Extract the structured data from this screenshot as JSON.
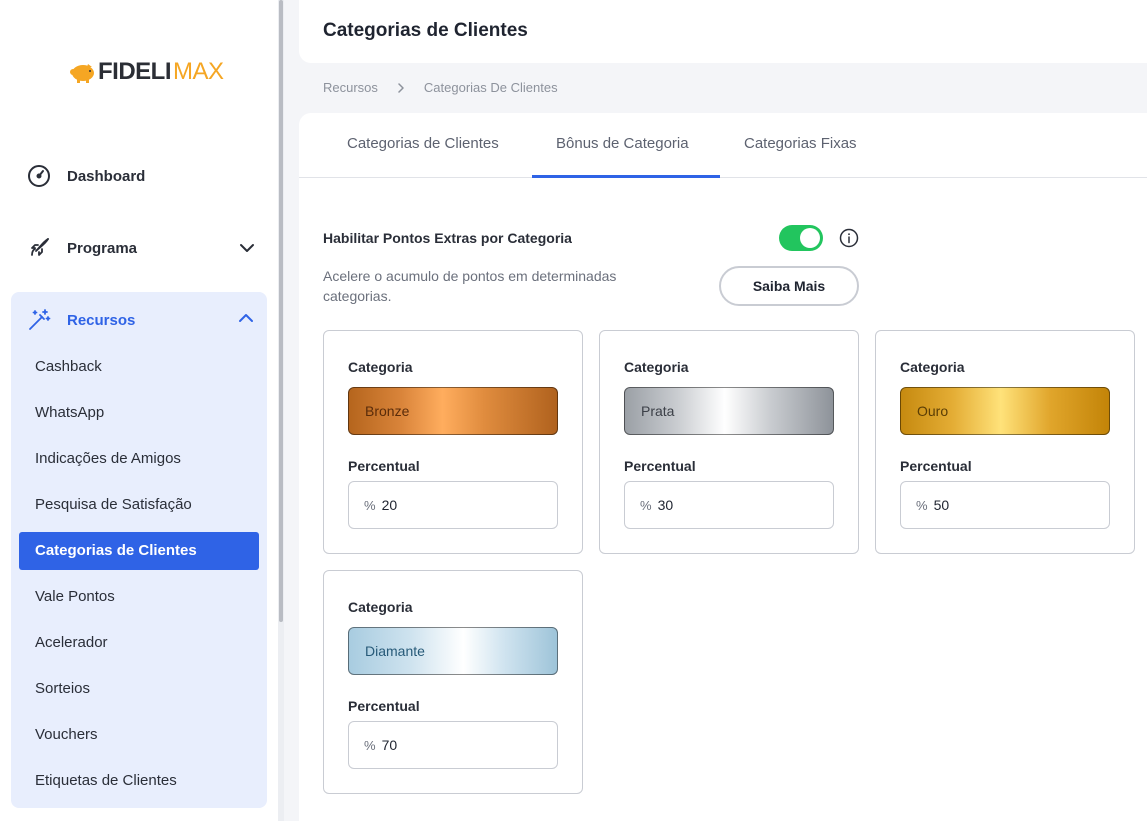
{
  "app": {
    "logo_part1": "FIDELI",
    "logo_part2": "MAX"
  },
  "sidebar": {
    "dashboard_label": "Dashboard",
    "programa_label": "Programa",
    "recursos_label": "Recursos",
    "items": [
      {
        "label": "Cashback"
      },
      {
        "label": "WhatsApp"
      },
      {
        "label": "Indicações de Amigos"
      },
      {
        "label": "Pesquisa de Satisfação"
      },
      {
        "label": "Categorias de Clientes",
        "active": true
      },
      {
        "label": "Vale Pontos"
      },
      {
        "label": "Acelerador"
      },
      {
        "label": "Sorteios"
      },
      {
        "label": "Vouchers"
      },
      {
        "label": "Etiquetas de Clientes"
      }
    ]
  },
  "header": {
    "title": "Categorias de Clientes"
  },
  "breadcrumb": {
    "items": [
      "Recursos",
      "Categorias De Clientes"
    ]
  },
  "tabs": [
    {
      "label": "Categorias de Clientes"
    },
    {
      "label": "Bônus de Categoria",
      "active": true
    },
    {
      "label": "Categorias Fixas"
    }
  ],
  "bonus": {
    "toggle_label": "Habilitar Pontos Extras por Categoria",
    "toggle_on": true,
    "description": "Acelere o acumulo de pontos em determinadas categorias.",
    "saiba_mais": "Saiba Mais",
    "categoria_label": "Categoria",
    "percentual_label": "Percentual",
    "percent_symbol": "%",
    "categories": [
      {
        "name": "Bronze",
        "percent": "20"
      },
      {
        "name": "Prata",
        "percent": "30"
      },
      {
        "name": "Ouro",
        "percent": "50"
      },
      {
        "name": "Diamante",
        "percent": "70"
      }
    ]
  },
  "colors": {
    "accent": "#2f63e6",
    "toggle_on": "#22c55e",
    "logo_orange": "#f5a623"
  }
}
